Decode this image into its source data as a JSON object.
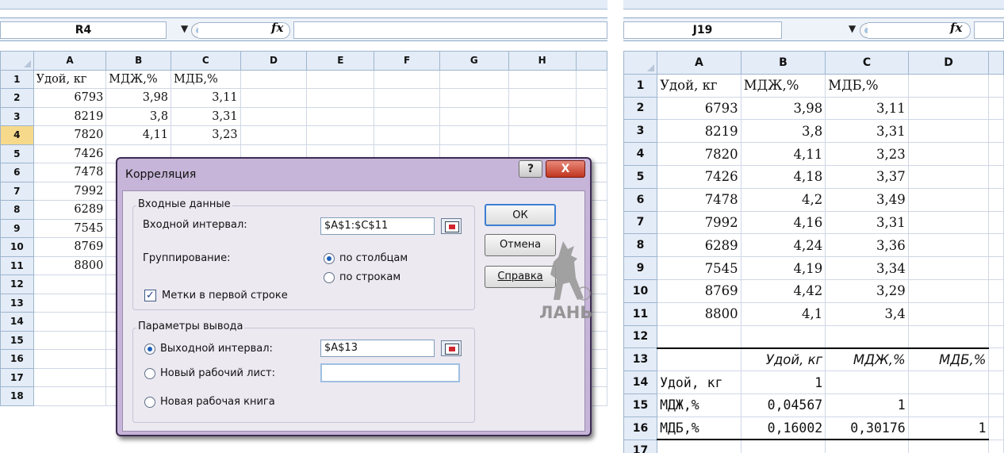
{
  "left": {
    "name_box": "R4",
    "fx_label": "fx",
    "columns": [
      "A",
      "B",
      "C",
      "D",
      "E",
      "F",
      "G",
      "H"
    ],
    "rows": [
      {
        "n": "1",
        "cells": [
          "Удой, кг",
          "МДЖ,%",
          "МДБ,%"
        ]
      },
      {
        "n": "2",
        "cells": [
          "6793",
          "3,98",
          "3,11"
        ]
      },
      {
        "n": "3",
        "cells": [
          "8219",
          "3,8",
          "3,31"
        ]
      },
      {
        "n": "4",
        "cells": [
          "7820",
          "4,11",
          "3,23"
        ]
      },
      {
        "n": "5",
        "cells": [
          "7426"
        ]
      },
      {
        "n": "6",
        "cells": [
          "7478"
        ]
      },
      {
        "n": "7",
        "cells": [
          "7992"
        ]
      },
      {
        "n": "8",
        "cells": [
          "6289"
        ]
      },
      {
        "n": "9",
        "cells": [
          "7545"
        ]
      },
      {
        "n": "10",
        "cells": [
          "8769"
        ]
      },
      {
        "n": "11",
        "cells": [
          "8800"
        ]
      },
      {
        "n": "12",
        "cells": []
      },
      {
        "n": "13",
        "cells": []
      },
      {
        "n": "14",
        "cells": []
      },
      {
        "n": "15",
        "cells": []
      },
      {
        "n": "16",
        "cells": []
      },
      {
        "n": "17",
        "cells": []
      },
      {
        "n": "18",
        "cells": []
      }
    ]
  },
  "dialog": {
    "title": "Корреляция",
    "help_glyph": "?",
    "close_glyph": "X",
    "input_group": "Входные данные",
    "input_range_label": "Входной интервал:",
    "input_range_value": "$A$1:$C$11",
    "grouping_label": "Группирование:",
    "by_columns": "по столбцам",
    "by_rows": "по строкам",
    "labels_first_row": "Метки в первой строке",
    "output_group": "Параметры вывода",
    "output_range_label": "Выходной интервал:",
    "output_range_value": "$A$13",
    "new_sheet_label": "Новый рабочий лист:",
    "new_book_label": "Новая рабочая книга",
    "ok_label": "ОК",
    "cancel_label": "Отмена",
    "help_label": "Справка"
  },
  "watermark": "ЛАНЬ",
  "right": {
    "name_box": "J19",
    "fx_label": "fx",
    "columns": [
      "A",
      "B",
      "C",
      "D"
    ],
    "rows": [
      {
        "n": "1",
        "cells": [
          "Удой, кг",
          "МДЖ,%",
          "МДБ,%",
          ""
        ]
      },
      {
        "n": "2",
        "cells": [
          "6793",
          "3,98",
          "3,11",
          ""
        ]
      },
      {
        "n": "3",
        "cells": [
          "8219",
          "3,8",
          "3,31",
          ""
        ]
      },
      {
        "n": "4",
        "cells": [
          "7820",
          "4,11",
          "3,23",
          ""
        ]
      },
      {
        "n": "5",
        "cells": [
          "7426",
          "4,18",
          "3,37",
          ""
        ]
      },
      {
        "n": "6",
        "cells": [
          "7478",
          "4,2",
          "3,49",
          ""
        ]
      },
      {
        "n": "7",
        "cells": [
          "7992",
          "4,16",
          "3,31",
          ""
        ]
      },
      {
        "n": "8",
        "cells": [
          "6289",
          "4,24",
          "3,36",
          ""
        ]
      },
      {
        "n": "9",
        "cells": [
          "7545",
          "4,19",
          "3,34",
          ""
        ]
      },
      {
        "n": "10",
        "cells": [
          "8769",
          "4,42",
          "3,29",
          ""
        ]
      },
      {
        "n": "11",
        "cells": [
          "8800",
          "4,1",
          "3,4",
          ""
        ]
      },
      {
        "n": "12",
        "cells": [
          "",
          "",
          "",
          ""
        ]
      },
      {
        "n": "13",
        "cells": [
          "",
          "Удой, кг",
          "МДЖ,%",
          "МДБ,%"
        ]
      },
      {
        "n": "14",
        "cells": [
          "Удой, кг",
          "1",
          "",
          ""
        ]
      },
      {
        "n": "15",
        "cells": [
          "МДЖ,%",
          "0,04567",
          "1",
          ""
        ]
      },
      {
        "n": "16",
        "cells": [
          "МДБ,%",
          "0,16002",
          "0,30176",
          "1"
        ]
      },
      {
        "n": "17",
        "cells": [
          "",
          "",
          "",
          ""
        ]
      }
    ]
  }
}
